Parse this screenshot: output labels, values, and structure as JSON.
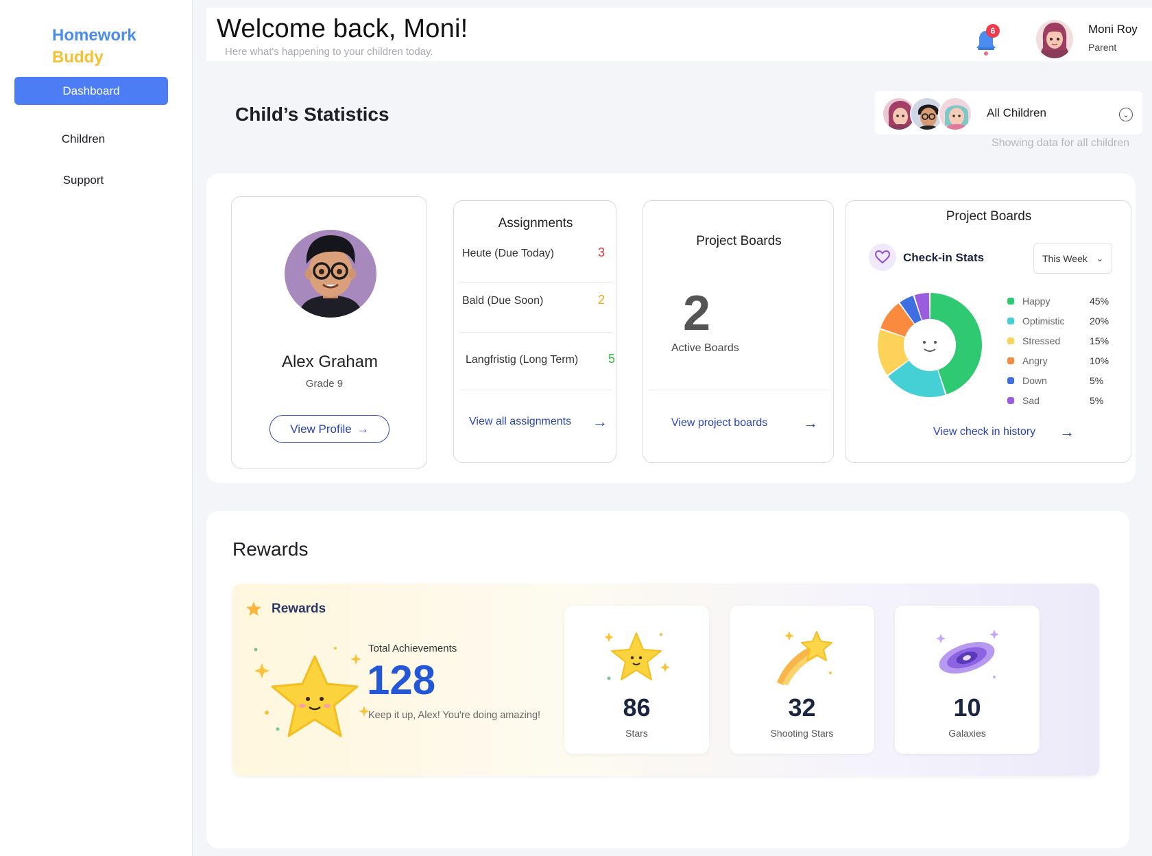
{
  "app": {
    "logo_line1": "Homework",
    "logo_line2": "Buddy"
  },
  "sidebar": {
    "items": [
      {
        "label": "Dashboard",
        "active": true
      },
      {
        "label": "Children",
        "active": false
      },
      {
        "label": "Support",
        "active": false
      }
    ]
  },
  "header": {
    "title": "Welcome back, Moni!",
    "subtitle": "Here what's happening to your children today.",
    "notifications": {
      "count": "6",
      "icon": "bell-icon"
    },
    "user": {
      "name": "Moni Roy",
      "role": "Parent"
    }
  },
  "stats": {
    "title": "Child’s Statistics",
    "child_selector": {
      "value": "All Children",
      "note": "Showing data for all children"
    }
  },
  "profile": {
    "name": "Alex Graham",
    "grade": "Grade 9",
    "button": "View Profile"
  },
  "assignments": {
    "title": "Assignments",
    "rows": [
      {
        "label": "Heute (Due Today)",
        "count": "3",
        "color": "#e2332e"
      },
      {
        "label": "Bald (Due Soon)",
        "count": "2",
        "color": "#f2a51a"
      },
      {
        "label": "Langfristig (Long Term)",
        "count": "5",
        "color": "#2fbf3b"
      }
    ],
    "link": "View all assignments"
  },
  "boards": {
    "title": "Project Boards",
    "count": "2",
    "label": "Active Boards",
    "link": "View project boards"
  },
  "mood": {
    "title": "Project Boards",
    "stats_label": "Check-in Stats",
    "period": "This Week",
    "link": "View check in history",
    "legend": [
      {
        "name": "Happy",
        "pct": "45%",
        "color": "#2ec970"
      },
      {
        "name": "Optimistic",
        "pct": "20%",
        "color": "#45d0d6"
      },
      {
        "name": "Stressed",
        "pct": "15%",
        "color": "#fcd258"
      },
      {
        "name": "Angry",
        "pct": "10%",
        "color": "#fa8a3d"
      },
      {
        "name": "Down",
        "pct": "5%",
        "color": "#3d6fe0"
      },
      {
        "name": "Sad",
        "pct": "5%",
        "color": "#9b5de0"
      }
    ]
  },
  "rewards": {
    "title": "Rewards",
    "banner_label": "Rewards",
    "total_label": "Total Achievements",
    "total": "128",
    "message": "Keep it up, Alex! You're doing amazing!",
    "cards": [
      {
        "value": "86",
        "caption": "Stars",
        "icon": "star-icon"
      },
      {
        "value": "32",
        "caption": "Shooting Stars",
        "icon": "shooting-star-icon"
      },
      {
        "value": "10",
        "caption": "Galaxies",
        "icon": "galaxy-icon"
      }
    ]
  }
}
